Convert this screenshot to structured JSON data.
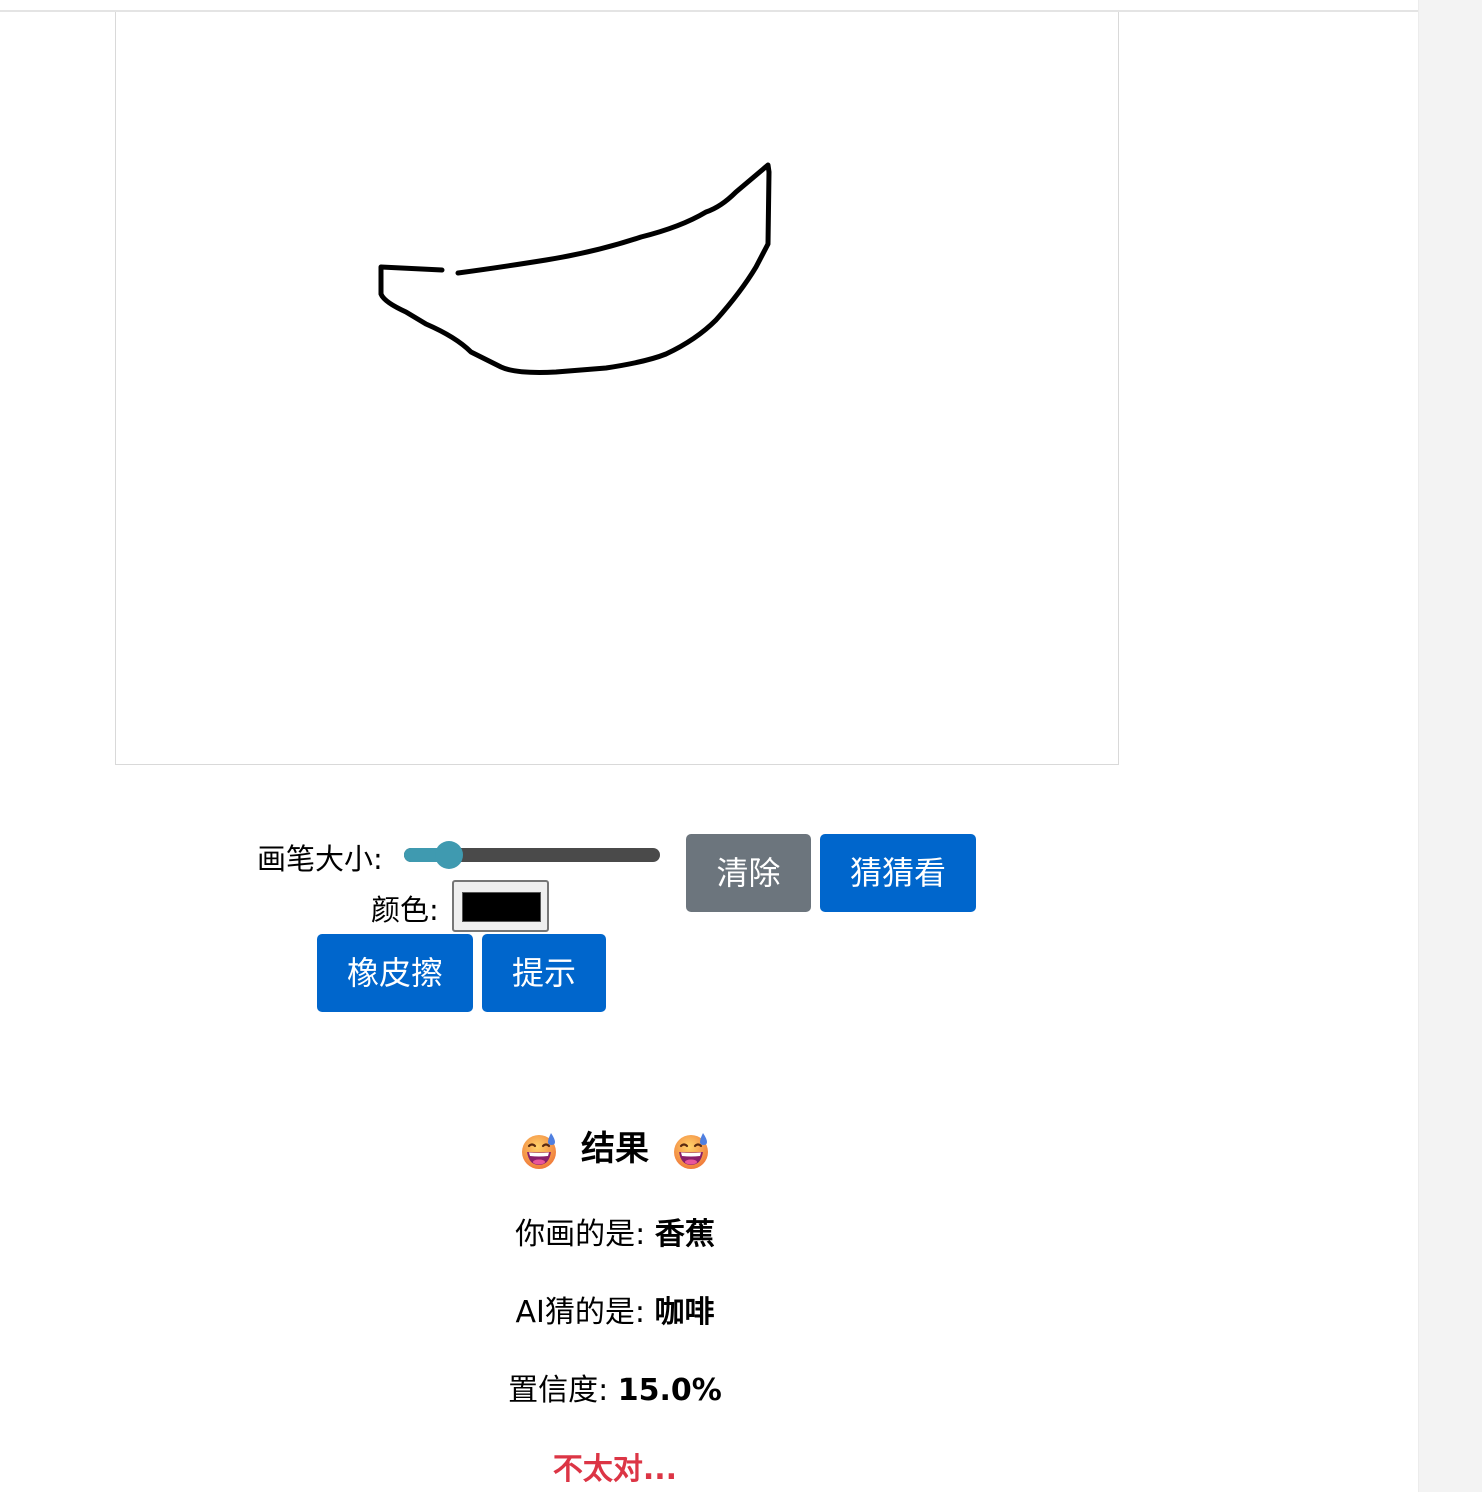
{
  "controls": {
    "brush_size_label": "画笔大小:",
    "brush_size_fraction": 0.15,
    "color_label": "颜色:",
    "color_value": "#000000"
  },
  "buttons": {
    "clear": "清除",
    "guess": "猜猜看",
    "eraser": "橡皮擦",
    "hint": "提示"
  },
  "result": {
    "title": "结果",
    "drawn_label": "你画的是:",
    "drawn_value": "香蕉",
    "ai_label": "AI猜的是:",
    "ai_value": "咖啡",
    "confidence_label": "置信度:",
    "confidence_value": "15.0%",
    "feedback": "不太对..."
  },
  "colors": {
    "primary": "#0066cc",
    "secondary": "#6c757d",
    "slider_accent": "#3f9ab0",
    "feedback": "#dc3545"
  },
  "icons": {
    "result_emoji": "grinning-face-with-sweat-emoji"
  }
}
